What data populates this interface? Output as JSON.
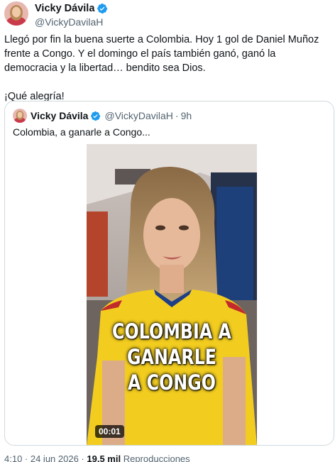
{
  "author": {
    "display_name": "Vicky Dávila",
    "handle": "@VickyDavilaH",
    "avatar_icon": "profile-photo",
    "verified_icon": "verified-badge-icon",
    "verified_color": "#1d9bf0"
  },
  "tweet": {
    "text": "Llegó por fin la buena suerte a Colombia. Hoy 1 gol de Daniel Muñoz frente a Congo. Y el domingo el país también ganó, ganó la democracia y la libertad… bendito sea Dios.",
    "text2": "¡Qué alegría!"
  },
  "quote": {
    "display_name": "Vicky Dávila",
    "handle": "@VickyDavilaH",
    "separator": "·",
    "time": "9h",
    "text": "Colombia, a ganarle a Congo...",
    "video": {
      "overlay_lines": [
        "COLOMBIA A",
        "GANARLE",
        "A CONGO"
      ],
      "duration": "00:01",
      "shirt_color": "#f2cd1f"
    }
  },
  "meta": {
    "timestamp": "4:10 · 24 jun 2026 ·",
    "views_count": "19,5 mil",
    "views_label": "Reproducciones"
  }
}
